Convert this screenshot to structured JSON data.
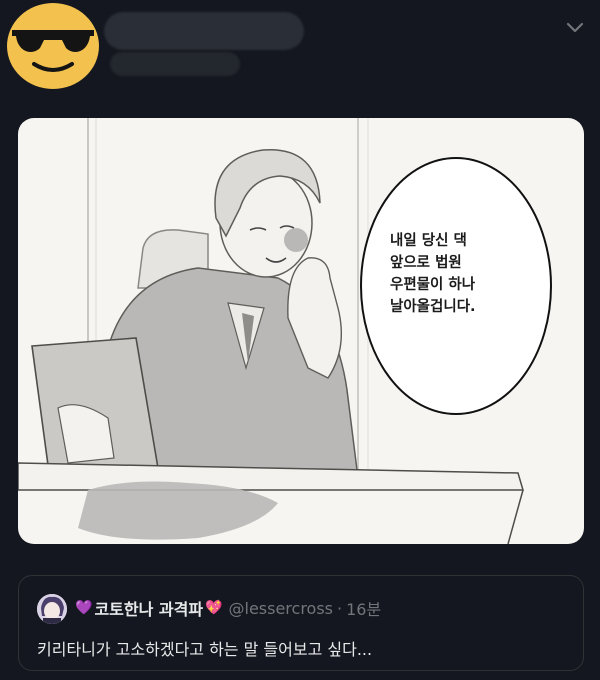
{
  "tweet": {
    "author_avatar_icon": "sunglasses-emoji-avatar-icon",
    "menu_icon": "chevron-down-icon"
  },
  "media": {
    "speech_bubble_lines": [
      "내일 당신 댁",
      "앞으로 법원",
      "우편물이 하나",
      "날아올겁니다."
    ]
  },
  "quoted_tweet": {
    "avatar_icon": "anime-avatar-icon",
    "heart_left": "💜",
    "display_name": "코토한나 과격파",
    "heart_right": "💖",
    "handle": "@lessercross",
    "separator": "·",
    "time": "16분",
    "text": "키리타니가 고소하겠다고 하는 말 들어보고 싶다..."
  },
  "colors": {
    "background": "#14171f",
    "text_primary": "#e7e9ea",
    "text_secondary": "#71767b",
    "border": "#2f3336"
  }
}
